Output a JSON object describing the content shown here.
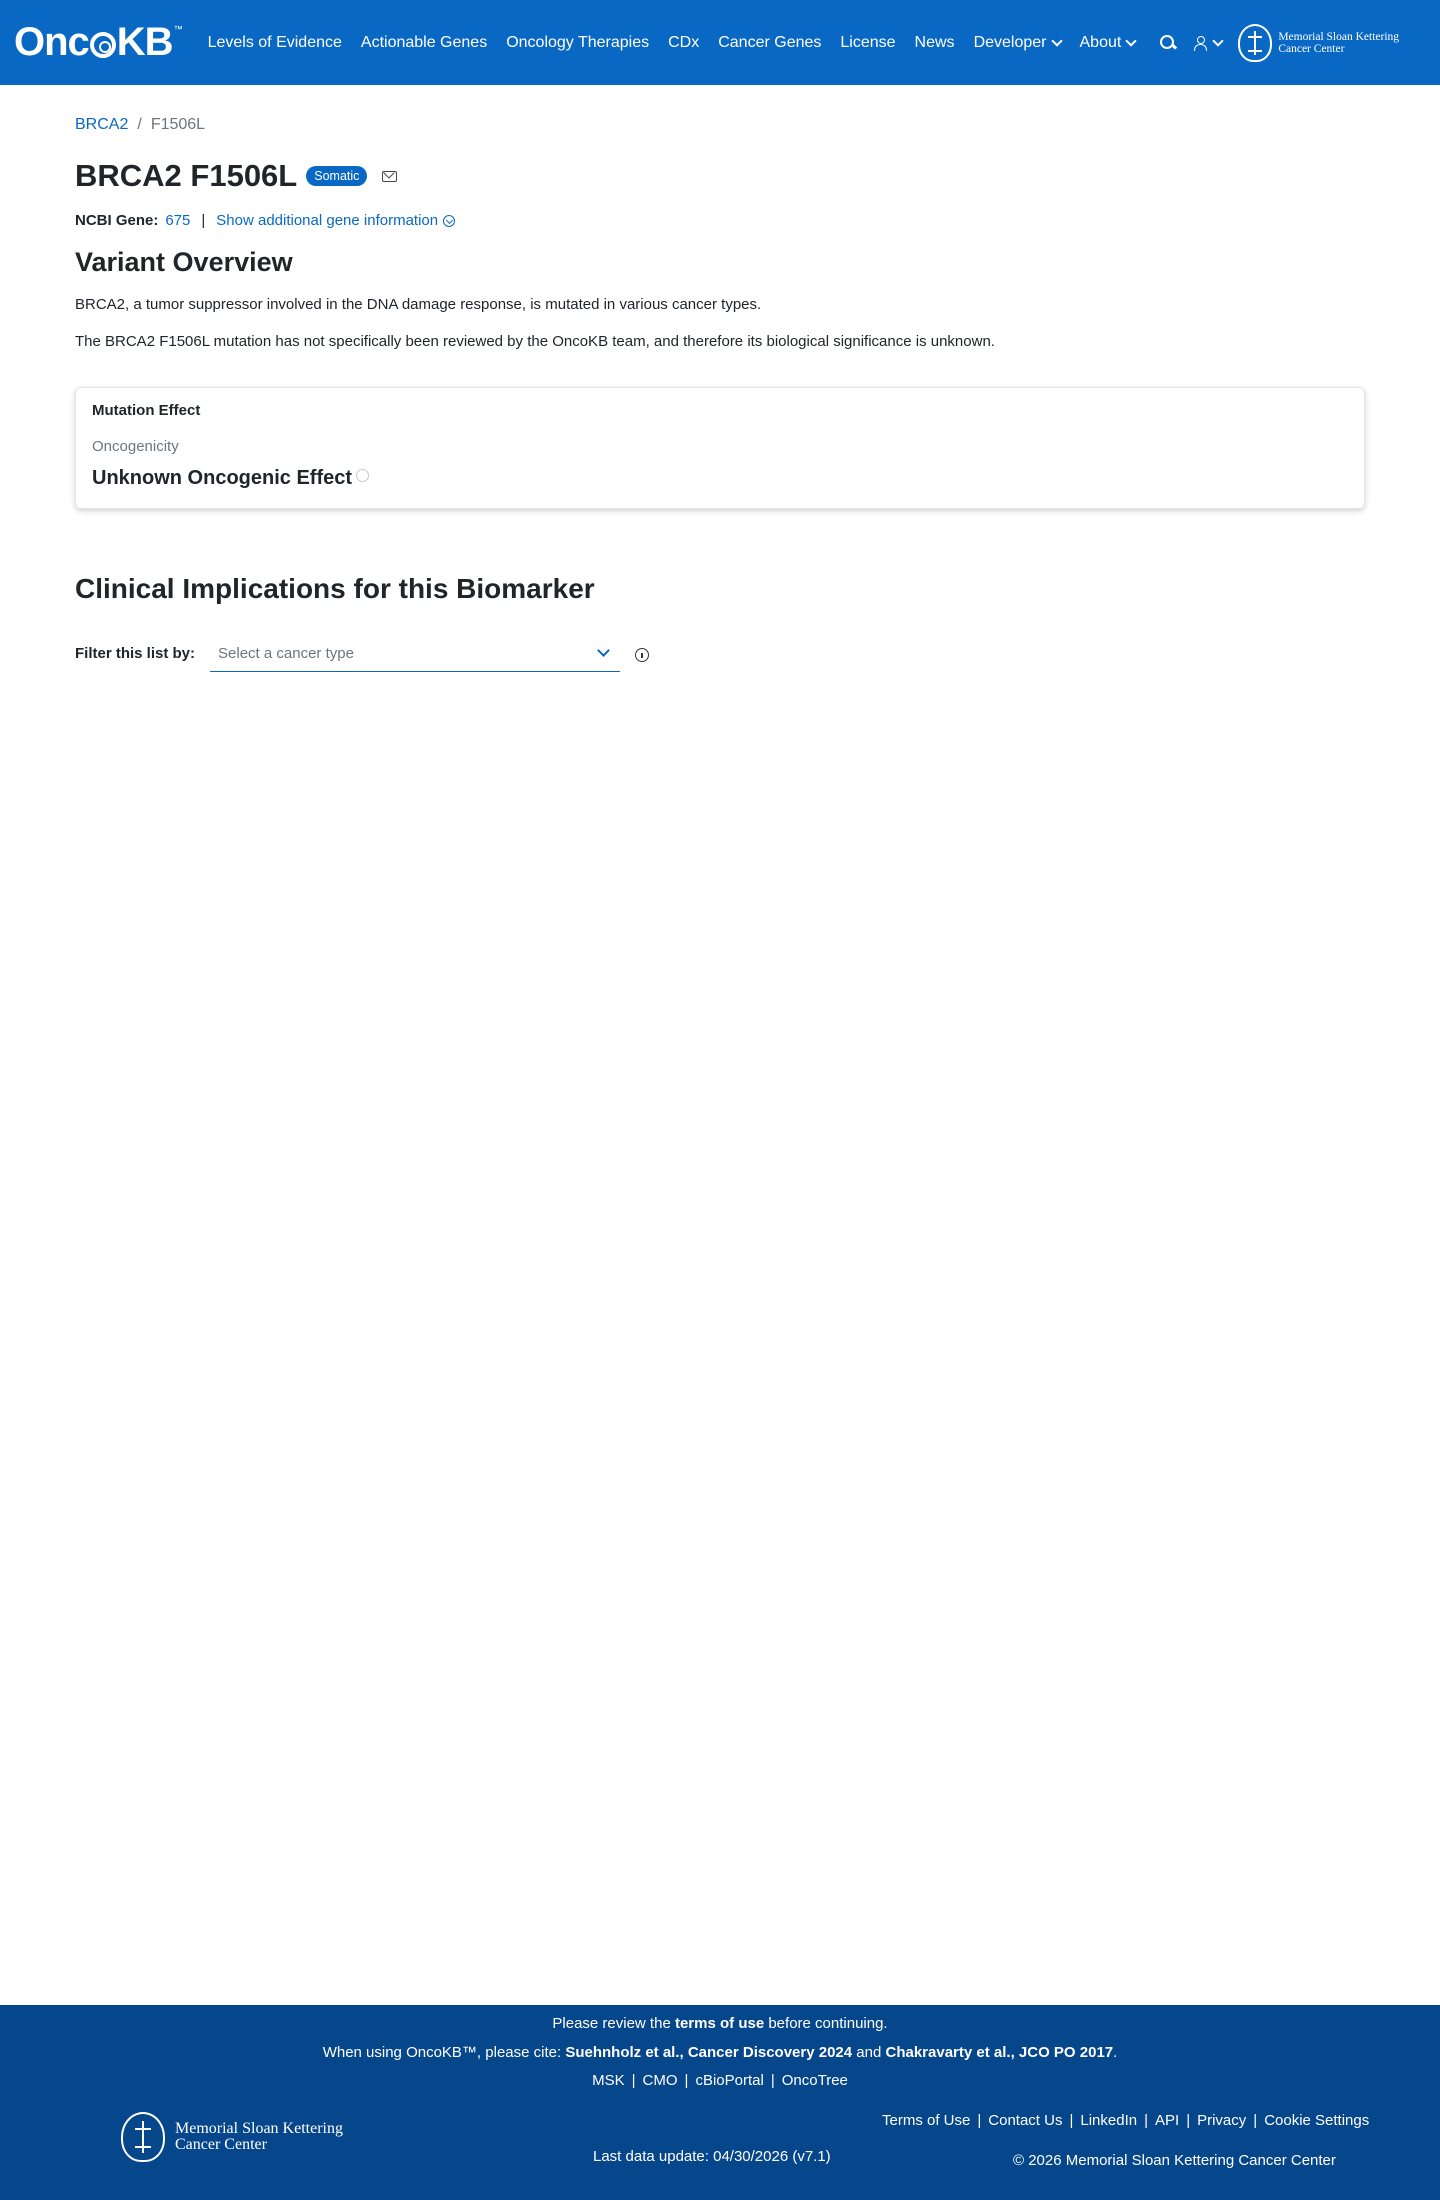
{
  "header": {
    "brand": "Onc",
    "brand_b": "KB",
    "brand_tm": "™",
    "nav": [
      "Levels of Evidence",
      "Actionable Genes",
      "Oncology Therapies",
      "CDx",
      "Cancer Genes",
      "License",
      "News"
    ],
    "developer": "Developer",
    "about": "About",
    "msk_line1": "Memorial Sloan Kettering",
    "msk_line2": "Cancer Center"
  },
  "breadcrumb": {
    "gene": "BRCA2",
    "sep": "/",
    "variant": "F1506L"
  },
  "title": {
    "text": "BRCA2 F1506L",
    "badge": "Somatic"
  },
  "gene_info": {
    "label": "NCBI Gene:",
    "id": "675",
    "pipe": "|",
    "more": "Show additional gene information"
  },
  "overview": {
    "heading": "Variant Overview",
    "p1": "BRCA2, a tumor suppressor involved in the DNA damage response, is mutated in various cancer types.",
    "p2": "The BRCA2 F1506L mutation has not specifically been reviewed by the OncoKB team, and therefore its biological significance is unknown."
  },
  "mutation_effect": {
    "title": "Mutation Effect",
    "label": "Oncogenicity",
    "value": "Unknown Oncogenic Effect"
  },
  "clinical": {
    "heading": "Clinical Implications for this Biomarker",
    "filter_label": "Filter this list by:",
    "select_placeholder": "Select a cancer type"
  },
  "footer": {
    "review_pre": "Please review the",
    "review_link": "terms of use",
    "review_post": "before continuing.",
    "cite_pre": "When using OncoKB™, please cite:",
    "cite_1": "Suehnholz et al., Cancer Discovery 2024",
    "cite_and": "and",
    "cite_2": "Chakravarty et al., JCO PO 2017",
    "cite_end": ".",
    "links": [
      "MSK",
      "CMO",
      "cBioPortal",
      "OncoTree"
    ],
    "last_update": "Last data update: 04/30/2026 (v7.1)",
    "right_links": [
      "Terms of Use",
      "Contact Us",
      "LinkedIn",
      "API",
      "Privacy",
      "Cookie Settings"
    ],
    "copyright": "© 2026 Memorial Sloan Kettering Cancer Center",
    "msk_line1": "Memorial Sloan Kettering",
    "msk_line2": "Cancer Center"
  }
}
